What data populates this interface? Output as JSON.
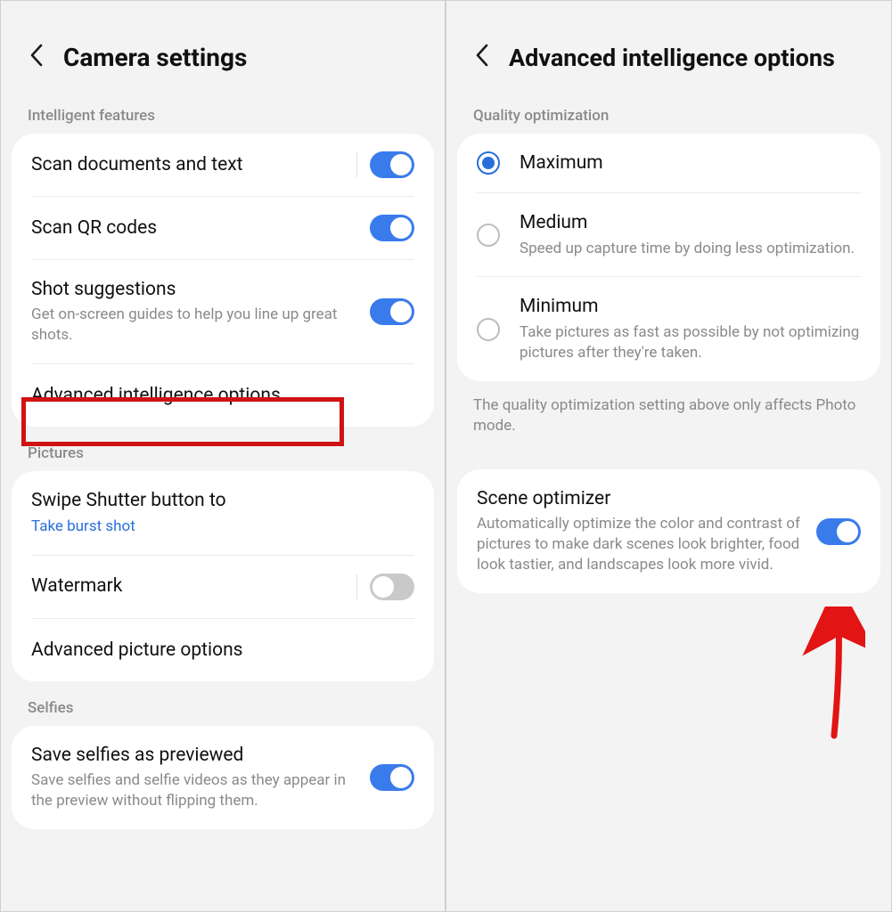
{
  "left": {
    "title": "Camera settings",
    "section_intelligent": "Intelligent features",
    "scan_docs": {
      "label": "Scan documents and text",
      "on": true
    },
    "scan_qr": {
      "label": "Scan QR codes",
      "on": true
    },
    "shot_suggestions": {
      "label": "Shot suggestions",
      "sub": "Get on-screen guides to help you line up great shots.",
      "on": true
    },
    "adv_intel": {
      "label": "Advanced intelligence options"
    },
    "section_pictures": "Pictures",
    "swipe_shutter": {
      "label": "Swipe Shutter button to",
      "value": "Take burst shot"
    },
    "watermark": {
      "label": "Watermark",
      "on": false
    },
    "adv_picture": {
      "label": "Advanced picture options"
    },
    "section_selfies": "Selfies",
    "save_selfies": {
      "label": "Save selfies as previewed",
      "sub": "Save selfies and selfie videos as they appear in the preview without flipping them.",
      "on": true
    }
  },
  "right": {
    "title": "Advanced intelligence options",
    "section_quality": "Quality optimization",
    "opt_max": {
      "label": "Maximum",
      "selected": true
    },
    "opt_med": {
      "label": "Medium",
      "sub": "Speed up capture time by doing less optimization.",
      "selected": false
    },
    "opt_min": {
      "label": "Minimum",
      "sub": "Take pictures as fast as possible by not optimizing pictures after they're taken.",
      "selected": false
    },
    "note": "The quality optimization setting above only affects Photo mode.",
    "scene": {
      "label": "Scene optimizer",
      "sub": "Automatically optimize the color and contrast of pictures to make dark scenes look brighter, food look tastier, and landscapes look more vivid.",
      "on": true
    }
  }
}
